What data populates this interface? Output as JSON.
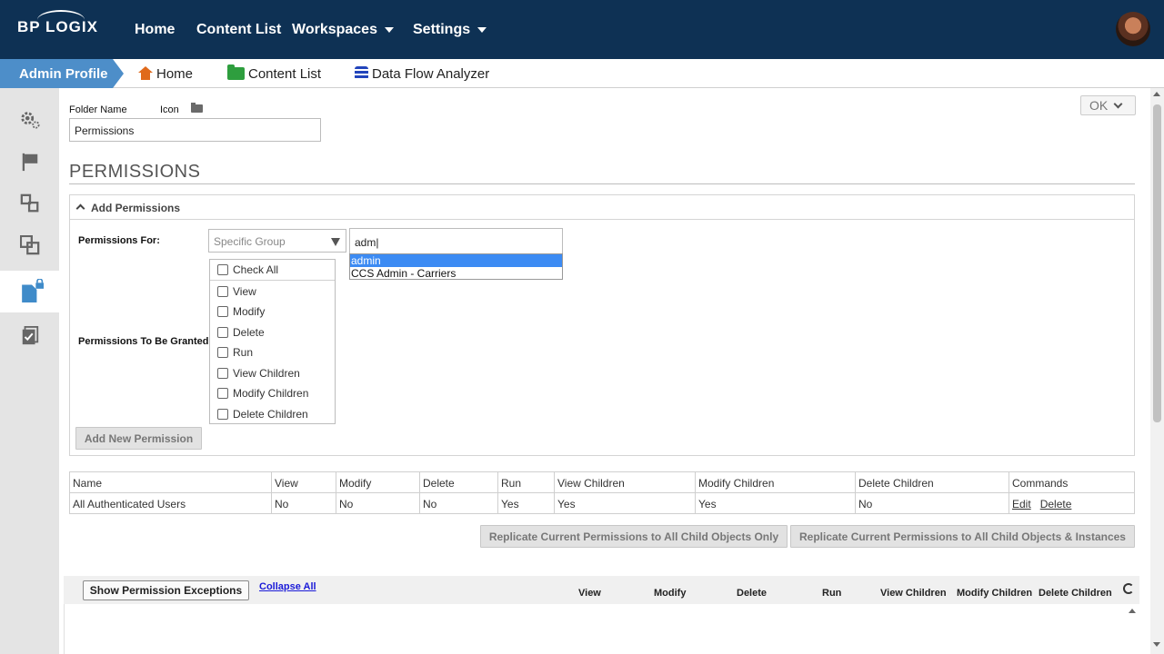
{
  "topnav": {
    "logo": "BP LOGIX",
    "items": [
      {
        "label": "Home",
        "dropdown": false
      },
      {
        "label": "Content List",
        "dropdown": false
      },
      {
        "label": "Workspaces",
        "dropdown": true
      },
      {
        "label": "Settings",
        "dropdown": true
      }
    ]
  },
  "breadcrumb": {
    "active": "Admin Profile",
    "items": [
      "Home",
      "Content List",
      "Data Flow Analyzer"
    ]
  },
  "sidebar": {
    "items": [
      "gear-icon",
      "flag-icon",
      "workflow-icon",
      "overlap-icon",
      "locked-document-icon",
      "checklist-icon"
    ],
    "active_index": 4
  },
  "form": {
    "folder_name_label": "Folder Name",
    "icon_label": "Icon",
    "folder_name_value": "Permissions",
    "ok_label": "OK"
  },
  "permissions": {
    "title": "PERMISSIONS",
    "add_panel_title": "Add Permissions",
    "permissions_for_label": "Permissions For:",
    "select_value": "Specific Group",
    "search_value": "adm",
    "suggestions": [
      "admin",
      "CCS Admin - Carriers"
    ],
    "selected_suggestion": 0,
    "to_be_granted_label": "Permissions To Be Granted",
    "check_all": "Check All",
    "checkboxes": [
      "View",
      "Modify",
      "Delete",
      "Run",
      "View Children",
      "Modify Children",
      "Delete Children"
    ],
    "add_button": "Add New Permission"
  },
  "table": {
    "headers": [
      "Name",
      "View",
      "Modify",
      "Delete",
      "Run",
      "View Children",
      "Modify Children",
      "Delete Children",
      "Commands"
    ],
    "rows": [
      {
        "cells": [
          "All Authenticated Users",
          "No",
          "No",
          "No",
          "Yes",
          "Yes",
          "Yes",
          "No"
        ],
        "edit": "Edit",
        "delete": "Delete"
      }
    ]
  },
  "replicate": {
    "children_only": "Replicate Current Permissions to All Child Objects Only",
    "children_instances": "Replicate Current Permissions to All Child Objects & Instances"
  },
  "exceptions": {
    "show_button": "Show Permission Exceptions",
    "collapse_all": "Collapse All",
    "columns": [
      "View",
      "Modify",
      "Delete",
      "Run",
      "View Children",
      "Modify Children",
      "Delete Children"
    ]
  },
  "colors": {
    "nav_bg": "#0e3154",
    "crumb_active": "#4d8ec9",
    "selection": "#3c8bf3"
  }
}
